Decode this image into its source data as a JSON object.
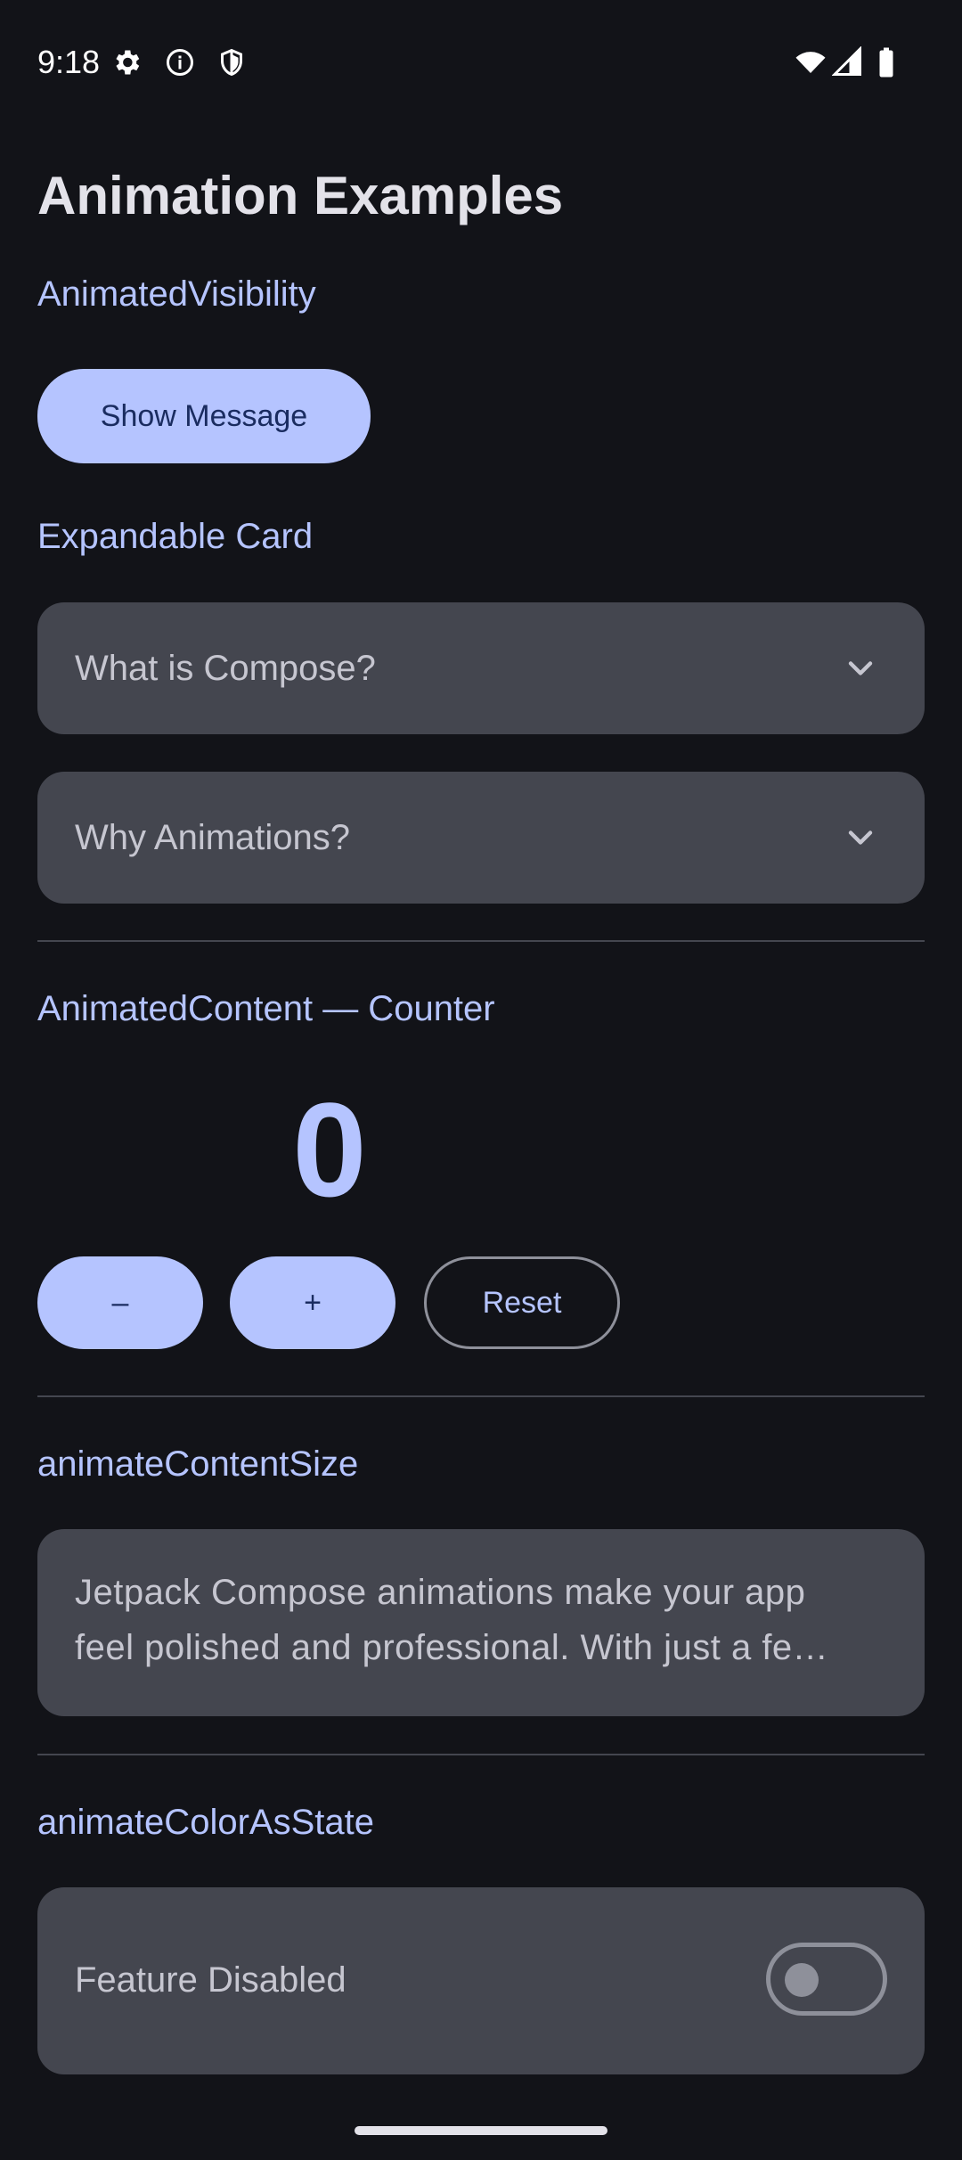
{
  "status_bar": {
    "time": "9:18",
    "left_icons": [
      "gear-icon",
      "info-icon",
      "shield-icon"
    ],
    "right_icons": [
      "wifi-icon",
      "signal-icon",
      "battery-icon"
    ]
  },
  "page": {
    "title": "Animation Examples"
  },
  "visibility_section": {
    "header": "AnimatedVisibility",
    "button_label": "Show Message"
  },
  "expandable_section": {
    "header": "Expandable Card",
    "cards": [
      {
        "title": "What is Compose?",
        "icon": "chevron-down-icon"
      },
      {
        "title": "Why Animations?",
        "icon": "chevron-down-icon"
      }
    ]
  },
  "counter_section": {
    "header": "AnimatedContent — Counter",
    "value": "0",
    "decrement_label": "–",
    "increment_label": "+",
    "reset_label": "Reset"
  },
  "size_section": {
    "header": "animateContentSize",
    "text_line1": "Jetpack Compose animations make your app",
    "text_line2": "feel polished and professional. With just a fe…"
  },
  "color_section": {
    "header": "animateColorAsState",
    "label": "Feature Disabled",
    "toggle_on": false
  },
  "colors": {
    "background": "#121318",
    "accent": "#b5c4ff",
    "card": "#44464f",
    "on_accent": "#1a2c60"
  }
}
